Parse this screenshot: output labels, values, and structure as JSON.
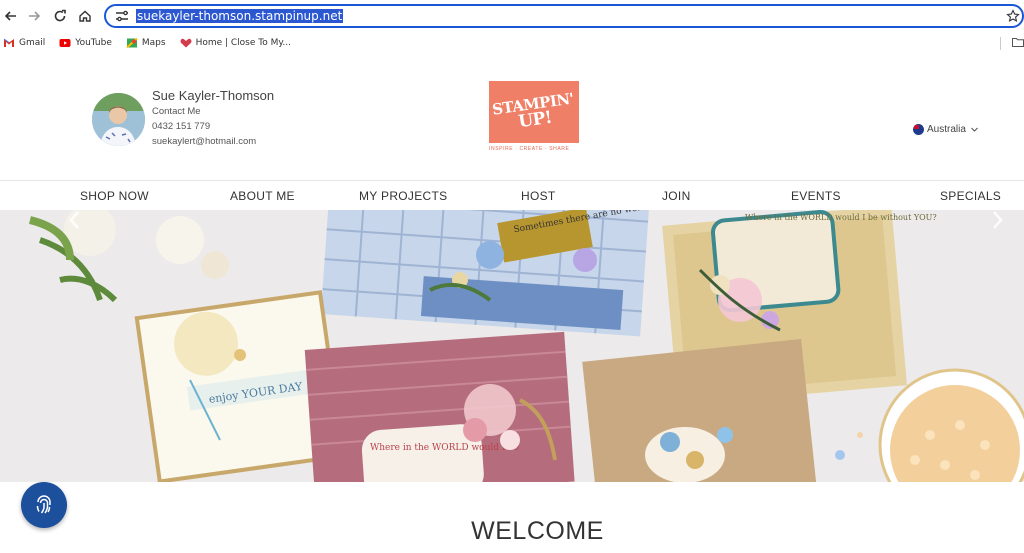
{
  "browser": {
    "url": "suekayler-thomson.stampinup.net",
    "bookmarks": [
      {
        "label": "Gmail",
        "icon": "gmail-icon"
      },
      {
        "label": "YouTube",
        "icon": "youtube-icon"
      },
      {
        "label": "Maps",
        "icon": "maps-icon"
      },
      {
        "label": "Home | Close To My...",
        "icon": "heart-icon"
      }
    ]
  },
  "header": {
    "name": "Sue Kayler-Thomson",
    "contact_label": "Contact Me",
    "phone": "0432 151 779",
    "email": "suekaylert@hotmail.com",
    "logo_text_1": "STAMPIN'",
    "logo_text_2": "UP!",
    "logo_tagline": "INSPIRE · CREATE · SHARE",
    "country": "Australia"
  },
  "nav": {
    "items": [
      "SHOP NOW",
      "ABOUT ME",
      "MY PROJECTS",
      "HOST",
      "JOIN",
      "EVENTS",
      "SPECIALS"
    ]
  },
  "hero": {
    "card_text_1": "Sometimes there are no words",
    "card_text_2": "Where in the WORLD would I be without YOU?",
    "card_text_3": "enjoy YOUR DAY",
    "card_text_4": "Where in the WORLD would I be"
  },
  "main": {
    "title": "WELCOME"
  },
  "colors": {
    "brand": "#f07f67",
    "fab": "#1c4f9c",
    "url_highlight": "#2b57d1"
  }
}
